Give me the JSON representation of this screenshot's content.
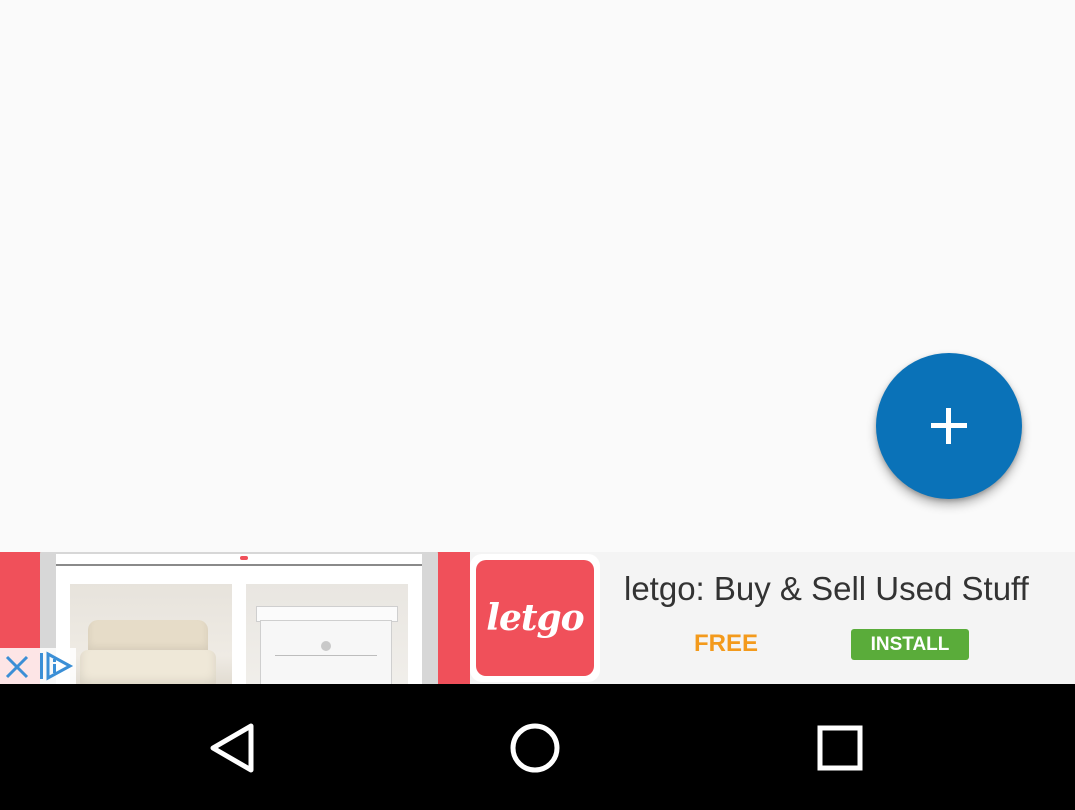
{
  "fab": {
    "icon": "plus-icon",
    "color": "#0a72b8"
  },
  "ad": {
    "logo_text": "letgo",
    "title": "letgo: Buy & Sell Used Stuff",
    "price": "FREE",
    "install_label": "INSTALL",
    "brand_color": "#f0505a",
    "install_color": "#5aac3a",
    "price_color": "#f39a1c",
    "close_icon": "close-icon",
    "adchoices_icon": "adchoices-icon"
  },
  "nav": {
    "back_icon": "back-triangle-icon",
    "home_icon": "home-circle-icon",
    "recents_icon": "recents-square-icon"
  }
}
